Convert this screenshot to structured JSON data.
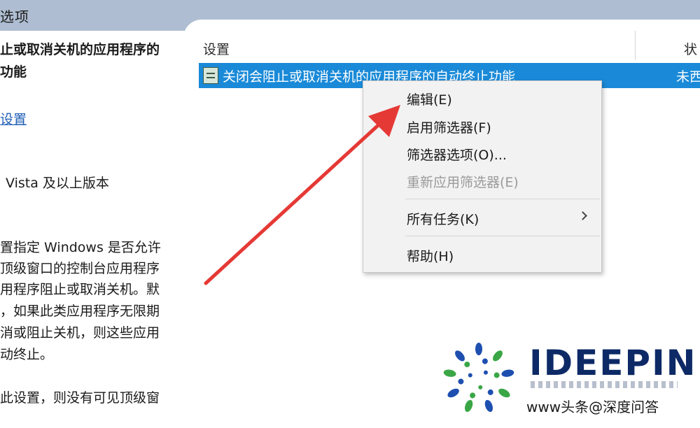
{
  "window": {
    "title": "选项"
  },
  "left_pane": {
    "heading_line1": "止或取消关机的应用程序的",
    "heading_line2": "功能",
    "settings_link": "设置",
    "requirement": "Vista 及以上版本",
    "description_lines": [
      "置指定 Windows 是否允许",
      "顶级窗口的控制台应用程序",
      "用程序阻止或取消关机。默",
      "，如果此类应用程序无限期",
      "消或阻止关机，则这些应用",
      "动终止。",
      "此设置，则没有可见顶级窗"
    ]
  },
  "list": {
    "col_setting": "设置",
    "col_state": "状",
    "selected_row": {
      "setting": "关闭会阻止或取消关机的应用程序的自动终止功能",
      "state": "未西"
    }
  },
  "context_menu": {
    "items": [
      {
        "label": "编辑(E)",
        "disabled": false
      },
      {
        "label": "启用筛选器(F)",
        "disabled": false
      },
      {
        "label": "筛选器选项(O)...",
        "disabled": false
      },
      {
        "label": "重新应用筛选器(E)",
        "disabled": true
      },
      {
        "label": "所有任务(K)",
        "disabled": false,
        "submenu": true
      },
      {
        "label": "帮助(H)",
        "disabled": false
      }
    ]
  },
  "watermark": {
    "brand": "IDEEPIN",
    "caption": "www头条@深度问答"
  },
  "colors": {
    "selection": "#1a8ad8",
    "title_bar": "#aebdd1",
    "annotation_arrow": "#e53935",
    "brand": "#0d2a66"
  }
}
